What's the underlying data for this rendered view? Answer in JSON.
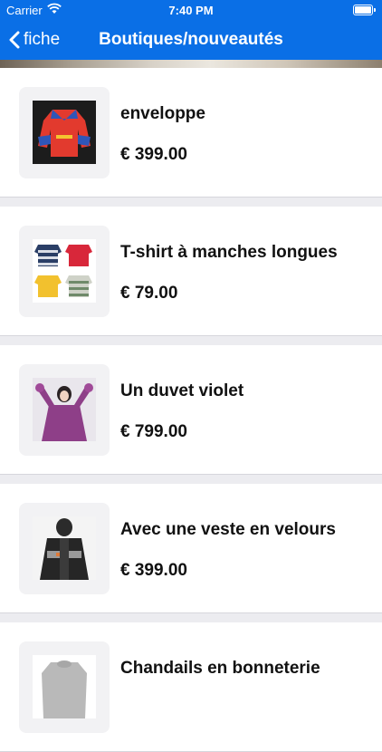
{
  "status_bar": {
    "carrier": "Carrier",
    "time": "7:40 PM"
  },
  "nav": {
    "back_label": "fiche",
    "title": "Boutiques/nouveautés"
  },
  "products": [
    {
      "name": "enveloppe",
      "price": "€ 399.00",
      "image": "red-blue-hoodie"
    },
    {
      "name": "T-shirt à manches longues",
      "price": "€ 79.00",
      "image": "kids-sweaters-grid"
    },
    {
      "name": "Un duvet violet",
      "price": "€ 799.00",
      "image": "purple-coat"
    },
    {
      "name": "Avec une veste en velours",
      "price": "€ 399.00",
      "image": "black-velvet-jacket"
    },
    {
      "name": "Chandails en bonneterie",
      "price": "",
      "image": "gray-knit-sweater"
    }
  ]
}
